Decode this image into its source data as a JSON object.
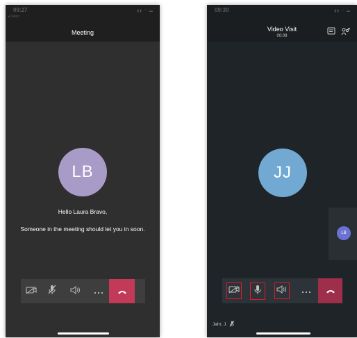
{
  "left_screen": {
    "status": {
      "time": "09:27",
      "back_label": "◂ Safari"
    },
    "title": "Meeting",
    "avatar": {
      "initials": "LB",
      "color": "#a99bc7"
    },
    "greeting": "Hello Laura Bravo,",
    "waiting_message": "Someone in the meeting should let you in soon.",
    "controls": [
      "camera-off",
      "mic-off",
      "speaker",
      "more",
      "end-call"
    ]
  },
  "right_screen": {
    "status": {
      "time": "09:30"
    },
    "title": "Video Visit",
    "timer": "00:09",
    "avatar": {
      "initials": "JJ",
      "color": "#71a9d2"
    },
    "side_participant": {
      "initials": "LB",
      "color": "#6b72d4"
    },
    "participant_label": "Jahr, J.",
    "controls": [
      "camera-off",
      "mic",
      "speaker",
      "more",
      "end-call"
    ]
  },
  "colors": {
    "end_call": "#c23a57",
    "highlight": "#d81d2c",
    "dark_bg_left": "#2f2f2f",
    "dark_bg_right": "#1f2428"
  }
}
